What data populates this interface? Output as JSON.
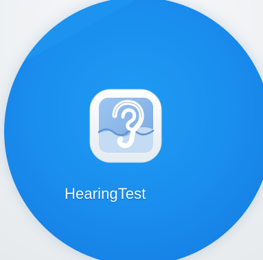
{
  "home_screen": {
    "apps": [
      {
        "label": "HearingTest",
        "icon": "ear-with-waveform-icon"
      }
    ]
  },
  "colors": {
    "wallpaper_blue": "#1a8fee",
    "icon_tile_white": "#f2f5f8",
    "icon_ear_blue": "#4d87cc",
    "label_text": "#f4f9ff"
  }
}
